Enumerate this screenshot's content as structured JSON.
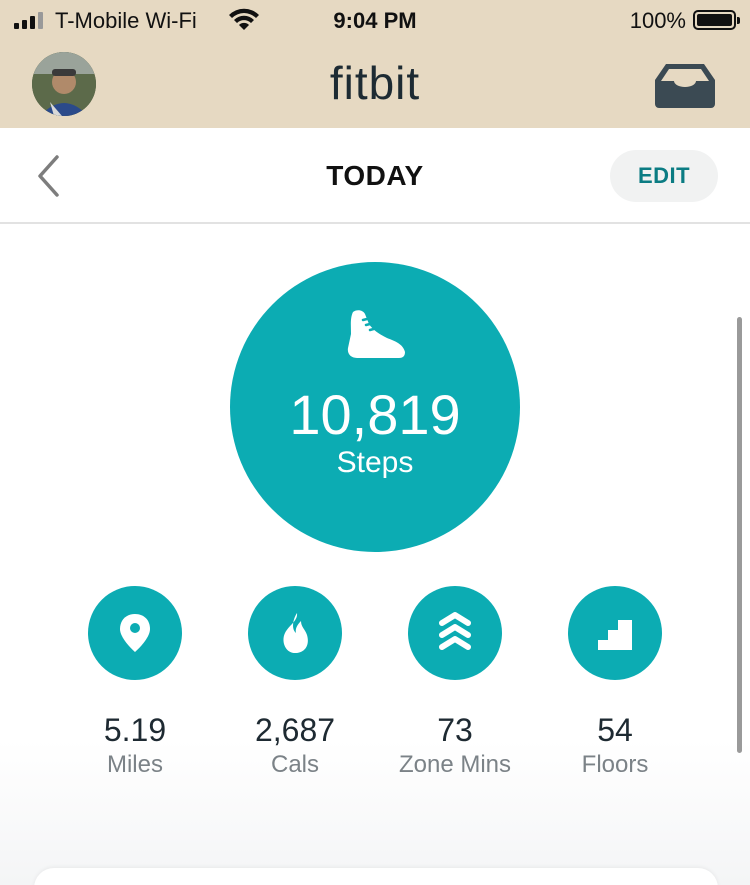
{
  "status_bar": {
    "carrier": "T-Mobile Wi-Fi",
    "time": "9:04 PM",
    "battery": "100%"
  },
  "header": {
    "brand": "fitbit",
    "avatar_icon": "user-avatar",
    "inbox_icon": "inbox-tray-icon"
  },
  "nav": {
    "title": "TODAY",
    "edit_label": "EDIT",
    "back_icon": "chevron-left-icon"
  },
  "steps": {
    "value": "10,819",
    "label": "Steps",
    "icon": "shoe-icon"
  },
  "stats": [
    {
      "value": "5.19",
      "label": "Miles",
      "icon": "location-pin-icon"
    },
    {
      "value": "2,687",
      "label": "Cals",
      "icon": "flame-icon"
    },
    {
      "value": "73",
      "label": "Zone Mins",
      "icon": "chevrons-up-icon"
    },
    {
      "value": "54",
      "label": "Floors",
      "icon": "stairs-icon"
    }
  ],
  "colors": {
    "accent_teal": "#0cacb3",
    "header_beige": "#e6d9c2",
    "edit_text": "#0b7c83"
  }
}
